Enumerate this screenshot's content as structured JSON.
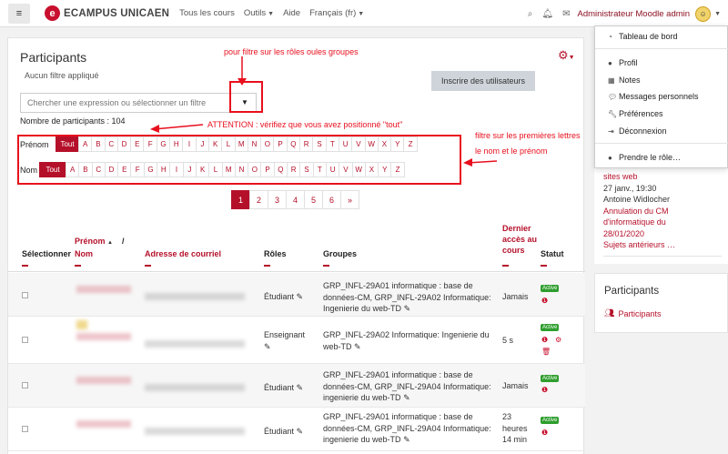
{
  "navbar": {
    "site_name": "ECAMPUS UNICAEN",
    "links": [
      "Tous les cours",
      "Outils",
      "Aide",
      "Français (fr)"
    ],
    "user_name": "Administrateur Moodle admin"
  },
  "main": {
    "title": "Participants",
    "no_filter": "Aucun filtre appliqué",
    "enroll_button": "Inscrire des utilisateurs",
    "search_placeholder": "Chercher une expression ou sélectionner un filtre",
    "participant_count": "Nombre de participants : 104",
    "firstname_label": "Prénom",
    "lastname_label": "Nom",
    "all_label": "Tout",
    "letters": [
      "A",
      "B",
      "C",
      "D",
      "E",
      "F",
      "G",
      "H",
      "I",
      "J",
      "K",
      "L",
      "M",
      "N",
      "O",
      "P",
      "Q",
      "R",
      "S",
      "T",
      "U",
      "V",
      "W",
      "X",
      "Y",
      "Z"
    ],
    "pages": [
      "1",
      "2",
      "3",
      "4",
      "5",
      "6",
      "»"
    ]
  },
  "annotations": {
    "roles_groups": "pour filtre sur les rôles oules groupes",
    "attention": "ATTENTION : vérifiez que vous avez positionné \"tout\"",
    "letters_filter_1": "filtre sur les premières lettres",
    "letters_filter_2": "le nom et le prénom"
  },
  "table": {
    "headers": {
      "select": "Sélectionner",
      "firstname": "Prénom",
      "slash": "/",
      "lastname": "Nom",
      "email": "Adresse de courriel",
      "roles": "Rôles",
      "groups": "Groupes",
      "last_access_1": "Dernier",
      "last_access_2": "accès au",
      "last_access_3": "cours",
      "status": "Statut"
    },
    "rows": [
      {
        "role": "Étudiant",
        "groups": [
          "GRP_INFL-29A01 informatique : base de",
          "données-CM, GRP_INFL-29A02 Informatique:",
          "Ingenierie du web-TD"
        ],
        "access": [
          "Jamais"
        ],
        "status": "Active"
      },
      {
        "role": "Enseignant",
        "groups": [
          "GRP_INFL-29A02 Informatique: Ingenierie du",
          "web-TD"
        ],
        "access": [
          "5 s"
        ],
        "status": "Active"
      },
      {
        "role": "Étudiant",
        "groups": [
          "GRP_INFL-29A01 informatique : base de",
          "données-CM, GRP_INFL-29A04 Informatique:",
          "ingenierie du web-TD"
        ],
        "access": [
          "Jamais"
        ],
        "status": "Active"
      },
      {
        "role": "Étudiant",
        "groups": [
          "GRP_INFL-29A01 informatique : base de",
          "données-CM, GRP_INFL-29A04 Informatique:",
          "ingenierie du web-TD"
        ],
        "access": [
          "23",
          "heures",
          "14 min"
        ],
        "status": "Active"
      }
    ]
  },
  "user_menu": {
    "items": [
      "Tableau de bord",
      "Profil",
      "Notes",
      "Messages personnels",
      "Préférences",
      "Déconnexion",
      "Prendre le rôle…"
    ]
  },
  "sidebar": {
    "news_lines": [
      "sites web",
      "27 janv., 19:30",
      "Antoine Widlocher",
      "Annulation du CM",
      "d'informatique du",
      "28/01/2020",
      "Sujets antérieurs …"
    ],
    "participants_title": "Participants",
    "participants_link": "Participants"
  }
}
